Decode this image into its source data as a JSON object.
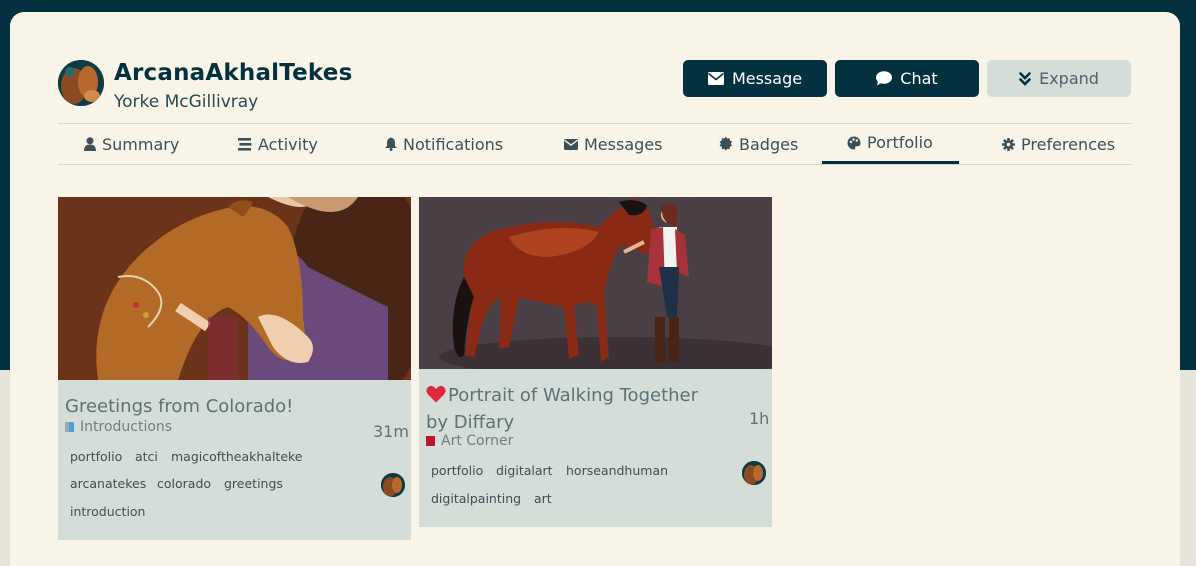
{
  "profile": {
    "username": "ArcanaAkhalTekes",
    "real_name": "Yorke McGillivray"
  },
  "actions": {
    "message": "Message",
    "chat": "Chat",
    "expand": "Expand"
  },
  "nav": {
    "summary": "Summary",
    "activity": "Activity",
    "notifications": "Notifications",
    "messages": "Messages",
    "badges": "Badges",
    "portfolio": "Portfolio",
    "preferences": "Preferences",
    "active": "Portfolio"
  },
  "topics": [
    {
      "title": "Greetings from Colorado!",
      "category": "Introductions",
      "category_color": "#4aa0d8",
      "age": "31m",
      "tags": [
        "portfolio",
        "atci",
        "magicoftheakhalteke",
        "arcanatekes",
        "colorado",
        "greetings",
        "introduction"
      ]
    },
    {
      "title_line1": "Portrait of Walking Together",
      "title_line2": "by Diffary",
      "category": "Art Corner",
      "category_color": "#c0142c",
      "age": "1h",
      "tags": [
        "portfolio",
        "digitalart",
        "horseandhuman",
        "digitalpainting",
        "art"
      ]
    }
  ],
  "colors": {
    "brand_dark": "#04313f",
    "card_bg": "#f8f5e8",
    "topic_bg": "#d4ddd8",
    "heart": "#e0293b"
  }
}
